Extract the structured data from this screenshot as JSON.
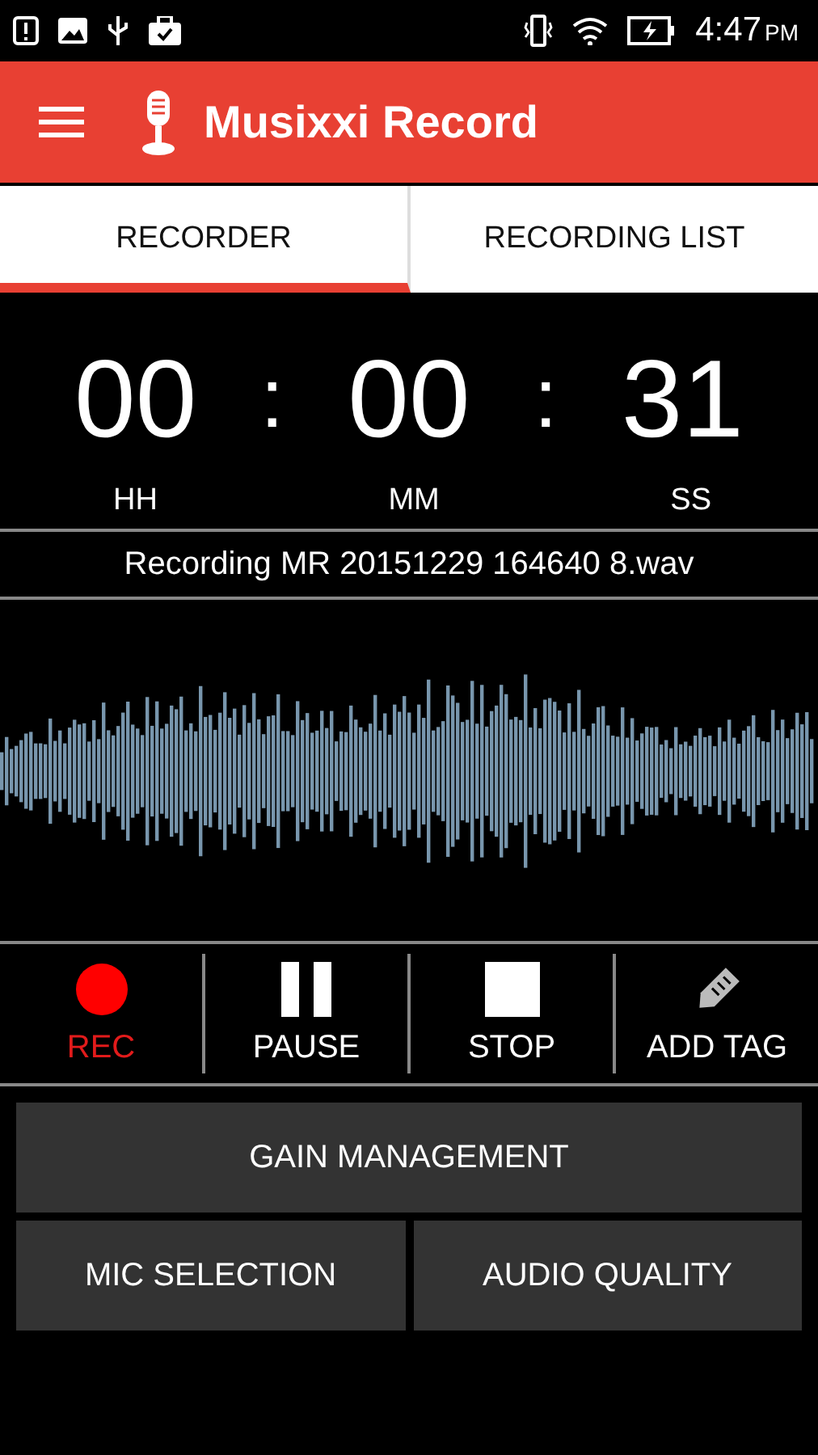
{
  "status_bar": {
    "time": "4:47",
    "ampm": "PM"
  },
  "app_bar": {
    "title": "Musixxi Record"
  },
  "tabs": [
    {
      "label": "RECORDER",
      "selected": true
    },
    {
      "label": "RECORDING LIST",
      "selected": false
    }
  ],
  "timer": {
    "hours": "00",
    "minutes": "00",
    "seconds": "31",
    "separator": ":",
    "units": [
      "HH",
      "MM",
      "SS"
    ]
  },
  "file_name": "Recording MR 20151229 164640 8.wav",
  "controls": [
    {
      "kind": "record",
      "label": "REC",
      "active": true
    },
    {
      "kind": "pause",
      "label": "PAUSE",
      "active": false
    },
    {
      "kind": "stop",
      "label": "STOP",
      "active": false
    },
    {
      "kind": "tag",
      "label": "ADD TAG",
      "active": false
    }
  ],
  "buttons": [
    [
      "GAIN MANAGEMENT"
    ],
    [
      "MIC SELECTION",
      "AUDIO QUALITY"
    ]
  ]
}
